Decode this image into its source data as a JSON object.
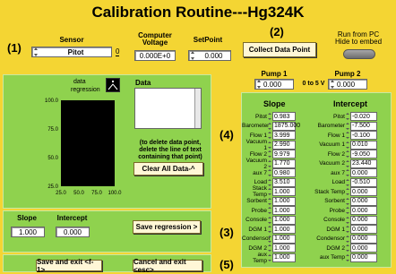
{
  "title": "Calibration Routine---Hg324K",
  "steps": {
    "s1": "(1)",
    "s2": "(2)",
    "s3": "(3)",
    "s4": "(4)",
    "s5": "(5)"
  },
  "top": {
    "sensor_label": "Sensor",
    "sensor_value": "Pitot",
    "sensor_index": "0",
    "computer_voltage_label": "Computer Voltage",
    "computer_voltage_value": "0.000E+0",
    "setpoint_label": "SetPoint",
    "setpoint_value": "0.000",
    "collect_button": "Collect Data Point",
    "run_from_pc": "Run from PC",
    "hide_to_embed": "Hide to embed"
  },
  "graph": {
    "data_label": "data",
    "regression_label": "regression",
    "data_box_label": "Data",
    "note": "(to delete data point, delete the line of text containing that point)",
    "clear_button": "Clear All Data-^"
  },
  "chart_data": {
    "type": "scatter",
    "x_ticks": [
      "25.0",
      "50.0",
      "75.0",
      "100.0"
    ],
    "y_ticks": [
      "100.0",
      "75.0",
      "50.0",
      "25.0"
    ],
    "xlim": [
      25,
      100
    ],
    "ylim": [
      25,
      100
    ],
    "series": []
  },
  "regression": {
    "slope_label": "Slope",
    "intercept_label": "Intercept",
    "slope_value": "1.000",
    "intercept_value": "0.000",
    "save_button": "Save regression >"
  },
  "exit": {
    "save_exit": "Save and exit <f-1>",
    "cancel_exit": "Cancel and exit <esc>"
  },
  "pumps": {
    "pump1_label": "Pump 1",
    "pump1_value": "0.000",
    "range_label": "0 to 5 V",
    "pump2_label": "Pump 2",
    "pump2_value": "0.000"
  },
  "table": {
    "slope_header": "Slope",
    "intercept_header": "Intercept",
    "rows": [
      {
        "name": "Pitot",
        "slope": "0.983",
        "intercept": "-0.020"
      },
      {
        "name": "Barometer",
        "slope": "1875.000",
        "intercept": "-7.500"
      },
      {
        "name": "Flow 1",
        "slope": "3.999",
        "intercept": "-0.100"
      },
      {
        "name": "Vacuum 1",
        "slope": "2.990",
        "intercept": "0.010"
      },
      {
        "name": "Flow 2",
        "slope": "9.979",
        "intercept": "-9.050"
      },
      {
        "name": "Vacuum 2",
        "slope": "1.770",
        "intercept": "23.440"
      },
      {
        "name": "aux 7",
        "slope": "0.980",
        "intercept": "0.000"
      },
      {
        "name": "Load",
        "slope": "3.510",
        "intercept": "-0.510"
      },
      {
        "name": "Stack Temp",
        "slope": "1.000",
        "intercept": "0.000"
      },
      {
        "name": "Sorbent",
        "slope": "1.000",
        "intercept": "0.000"
      },
      {
        "name": "Probe",
        "slope": "1.000",
        "intercept": "0.000"
      },
      {
        "name": "Console",
        "slope": "1.000",
        "intercept": "0.000"
      },
      {
        "name": "DGM 1",
        "slope": "1.000",
        "intercept": "0.000"
      },
      {
        "name": "Condensor",
        "slope": "1.000",
        "intercept": "0.000"
      },
      {
        "name": "DGM 2",
        "slope": "1.000",
        "intercept": "0.000"
      },
      {
        "name": "aux Temp",
        "slope": "1.000",
        "intercept": "0.000"
      }
    ]
  },
  "colors": {
    "background": "#f4d533",
    "panel": "#8fd24e",
    "field": "#ffffff",
    "button": "#fff7d6"
  }
}
